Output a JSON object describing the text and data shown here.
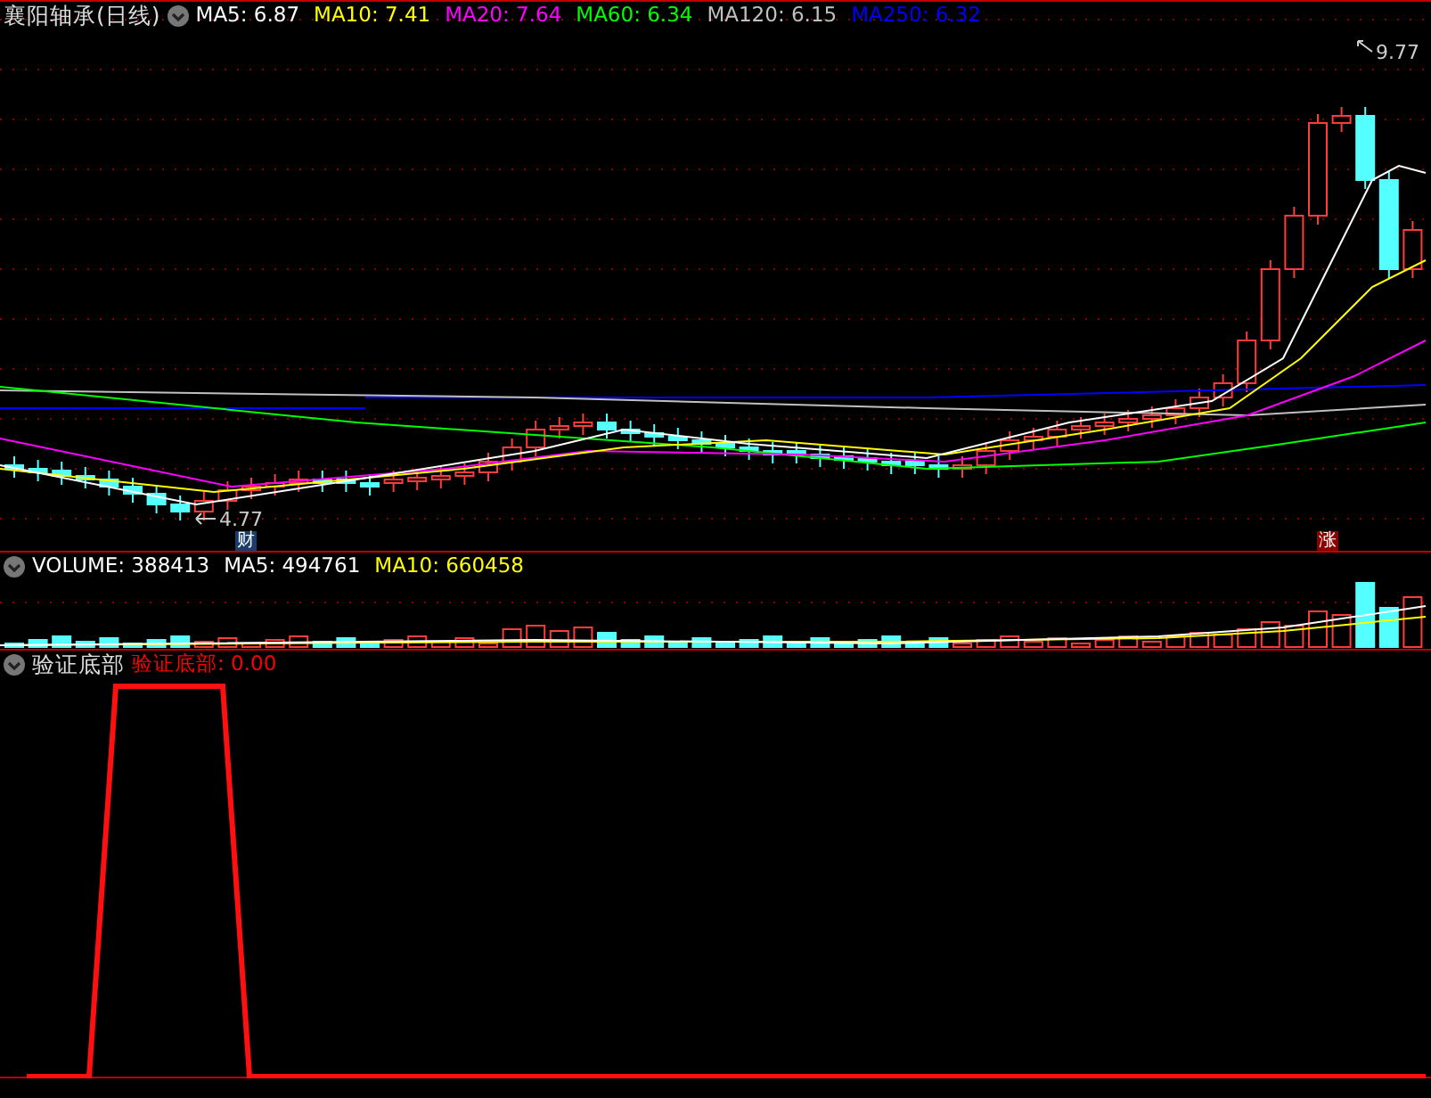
{
  "title": "襄阳轴承(日线)",
  "price_legend": [
    {
      "label": "MA5: 6.87",
      "color": "#ffffff"
    },
    {
      "label": "MA10: 7.41",
      "color": "#ffff00"
    },
    {
      "label": "MA20: 7.64",
      "color": "#ff00ff"
    },
    {
      "label": "MA60: 6.34",
      "color": "#00ff00"
    },
    {
      "label": "MA120: 6.15",
      "color": "#c0c0c0"
    },
    {
      "label": "MA250: 6.32",
      "color": "#0000ff"
    }
  ],
  "price_labels": {
    "high": "9.77",
    "low": "4.77"
  },
  "markers": [
    {
      "text": "财",
      "color": "#1a3d6b"
    },
    {
      "text": "涨",
      "color": "#8b0000"
    }
  ],
  "volume_legend": [
    {
      "label": "VOLUME: 388413",
      "color": "#ffffff"
    },
    {
      "label": "MA5: 494761",
      "color": "#ffffff"
    },
    {
      "label": "MA10: 660458",
      "color": "#ffff00"
    }
  ],
  "indicator": {
    "name": "验证底部",
    "legend": [
      {
        "label": "验证底部: 0.00",
        "color": "#ff0000"
      }
    ]
  }
}
